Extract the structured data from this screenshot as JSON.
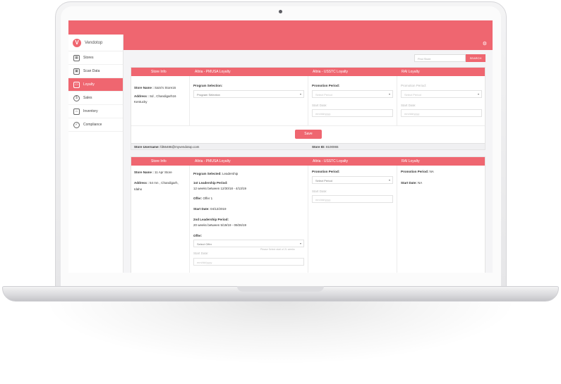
{
  "app": {
    "brand": "Vendotop"
  },
  "sidebar": {
    "items": [
      {
        "label": "Stores",
        "icon": "store-icon"
      },
      {
        "label": "Scan Data",
        "icon": "scan-icon"
      },
      {
        "label": "Loyalty",
        "icon": "card-icon",
        "active": true
      },
      {
        "label": "Sales",
        "icon": "dollar-icon"
      },
      {
        "label": "Inventory",
        "icon": "box-icon"
      },
      {
        "label": "Compliance",
        "icon": "check-icon"
      }
    ]
  },
  "search": {
    "placeholder": "Find Store",
    "button": "SEARCH"
  },
  "card1": {
    "headers": [
      "Store Info",
      "Altria - PMUSA Loyalty",
      "Altria - USSTC Loyalty",
      "RAI Loyalty"
    ],
    "store_name_label": "Store Name :",
    "store_name": "Saini's Store16",
    "address_label": "Address :",
    "address": "Sd , Chandigarh16",
    "address_line2": "Kentucky",
    "program_selection_label": "Program Selection:",
    "program_selection_value": "Program Selection",
    "usstc_period_label": "Promotion Period:",
    "usstc_period_value": "Select Period",
    "usstc_start_label": "Start Date:",
    "usstc_start_placeholder": "mm/dd/yyyy",
    "rai_period_label": "Promotion Period:",
    "rai_period_value": "Select Period",
    "rai_start_label": "Start Date:",
    "rai_start_placeholder": "mm/dd/yyyy",
    "save_label": "Save",
    "footer_user_label": "Store Username:",
    "footer_user": "fd56486@myvendotop.com",
    "footer_id_label": "Store ID:",
    "footer_id": "8100065"
  },
  "card2": {
    "headers": [
      "Store Info",
      "Altria - PMUSA Loyalty",
      "Altria - USSTC Loyalty",
      "RAI Loyalty"
    ],
    "store_name_label": "Store Name :",
    "store_name": "11 Apr Store",
    "address_label": "Address :",
    "address": "54 mn , Chandigarh,",
    "address_line2": "Idaho",
    "program_selected_label": "Program Selected:",
    "program_selected": "Leadership",
    "lp1_label": "1st Leadership Period:",
    "lp1_value": "12 weeks between 12/30/18 - 4/13/19",
    "offer_label": "Offer:",
    "offer_value": "Offer 1",
    "start_label": "Start Date:",
    "start_value": "04/12/2019",
    "lp2_label": "2nd Leadership Period:",
    "lp2_value": "20 weeks between 5/19/19 - 09/26/19",
    "offer2_label": "Offer:",
    "offer2_select": "Select Offer",
    "offer2_hint": "Please Select start of 2L weeks",
    "start2_label": "Start Date:",
    "start2_placeholder": "mm/dd/yyyy",
    "usstc_period_label": "Promotion Period:",
    "usstc_period_value": "Select Period",
    "usstc_start_label": "Start Date:",
    "usstc_start_placeholder": "mm/dd/yyyy",
    "rai_period_label": "Promotion Period:",
    "rai_period_value": "NA",
    "rai_start_label": "Start Date:",
    "rai_start_value": "NA"
  }
}
